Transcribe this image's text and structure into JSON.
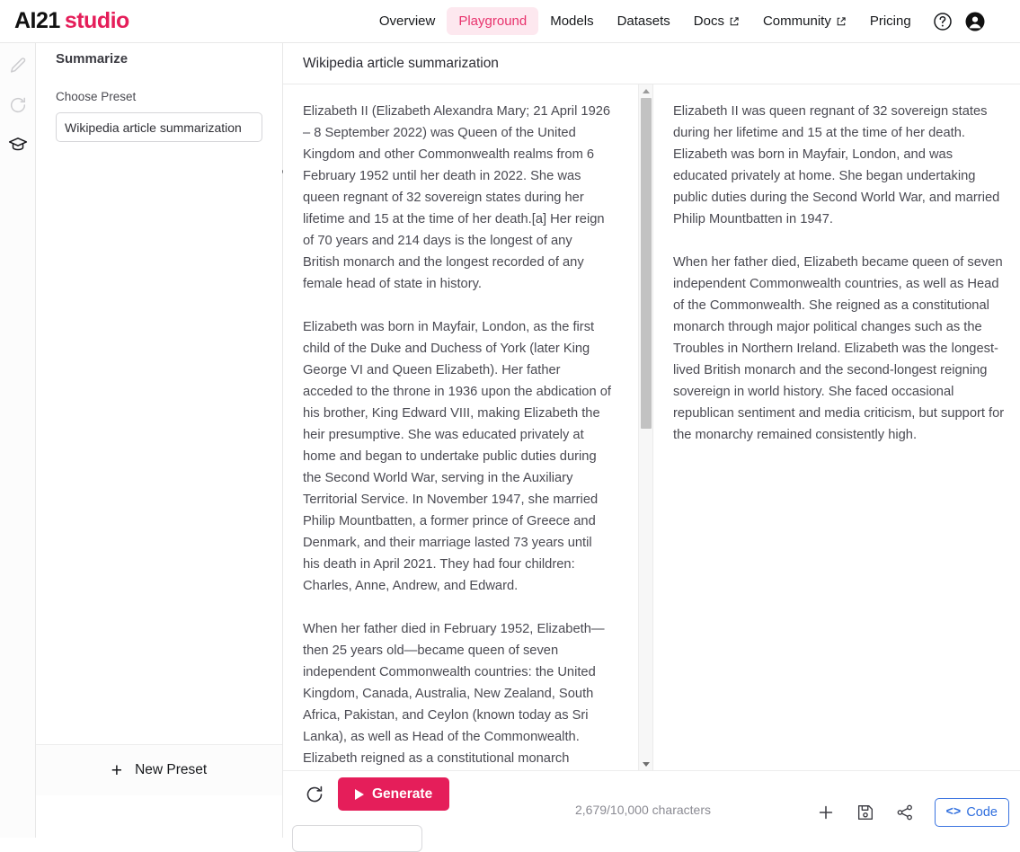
{
  "brand": {
    "part1": "AI21",
    "part2": "studio"
  },
  "nav": {
    "items": [
      {
        "label": "Overview",
        "external": false,
        "active": false,
        "name": "nav-overview"
      },
      {
        "label": "Playground",
        "external": false,
        "active": true,
        "name": "nav-playground"
      },
      {
        "label": "Models",
        "external": false,
        "active": false,
        "name": "nav-models"
      },
      {
        "label": "Datasets",
        "external": false,
        "active": false,
        "name": "nav-datasets"
      },
      {
        "label": "Docs",
        "external": true,
        "active": false,
        "name": "nav-docs"
      },
      {
        "label": "Community",
        "external": true,
        "active": false,
        "name": "nav-community"
      },
      {
        "label": "Pricing",
        "external": false,
        "active": false,
        "name": "nav-pricing"
      }
    ],
    "help_icon": "help-circle-icon",
    "avatar_icon": "user-avatar-icon"
  },
  "rail": {
    "icons": [
      {
        "name": "pencil-icon",
        "active": false
      },
      {
        "name": "history-icon",
        "active": false
      },
      {
        "name": "graduation-cap-icon",
        "active": true
      }
    ]
  },
  "preset_panel": {
    "title": "Summarize",
    "choose_preset_label": "Choose Preset",
    "selected_preset": "Wikipedia article summarization",
    "new_preset_label": "New Preset",
    "new_preset_plus": "+"
  },
  "main": {
    "header_title": "Wikipedia article summarization",
    "input": {
      "paragraphs": [
        "Elizabeth II (Elizabeth Alexandra Mary; 21 April 1926 – 8 September 2022) was Queen of the United Kingdom and other Commonwealth realms from 6 February 1952 until her death in 2022. She was queen regnant of 32 sovereign states during her lifetime and 15 at the time of her death.[a] Her reign of 70 years and 214 days is the longest of any British monarch and the longest recorded of any female head of state in history.",
        "Elizabeth was born in Mayfair, London, as the first child of the Duke and Duchess of York (later King George VI and Queen Elizabeth). Her father acceded to the throne in 1936 upon the abdication of his brother, King Edward VIII, making Elizabeth the heir presumptive. She was educated privately at home and began to undertake public duties during the Second World War, serving in the Auxiliary Territorial Service. In November 1947, she married Philip Mountbatten, a former prince of Greece and Denmark, and their marriage lasted 73 years until his death in April 2021. They had four children: Charles, Anne, Andrew, and Edward.",
        "When her father died in February 1952, Elizabeth—then 25 years old—became queen of seven independent Commonwealth countries: the United Kingdom, Canada, Australia, New Zealand, South Africa, Pakistan, and Ceylon (known today as Sri Lanka), as well as Head of the Commonwealth. Elizabeth reigned as a constitutional monarch"
      ]
    },
    "output": {
      "lines": [
        "Elizabeth II was queen regnant of 32 sovereign states during her lifetime and 15 at the time of her death. Elizabeth was born in Mayfair, London, and was educated privately at home. She began undertaking public duties during the Second World War, and married Philip Mountbatten in 1947.",
        "When her father died, Elizabeth became queen of seven independent Commonwealth countries, as well as Head of the Commonwealth. She reigned as a constitutional monarch through major political changes such as the Troubles in Northern Ireland. Elizabeth was the longest-lived British monarch and the second-longest reigning sovereign in world history. She faced occasional republican sentiment and media criticism, but support for the monarchy remained consistently high."
      ]
    }
  },
  "bottom": {
    "refresh_icon": "refresh-icon",
    "generate_label": "Generate",
    "char_count": "2,679/10,000 characters",
    "add_icon": "plus-icon",
    "save_icon": "save-disk-icon",
    "share_icon": "share-icon",
    "code_label": "Code",
    "code_chevrons": "<>"
  },
  "colors": {
    "accent_pink": "#e51e5a",
    "active_nav_text": "#e8336d",
    "active_nav_bg": "#fde8ef",
    "code_blue": "#2f6ede",
    "body_text": "#4a4a52"
  }
}
